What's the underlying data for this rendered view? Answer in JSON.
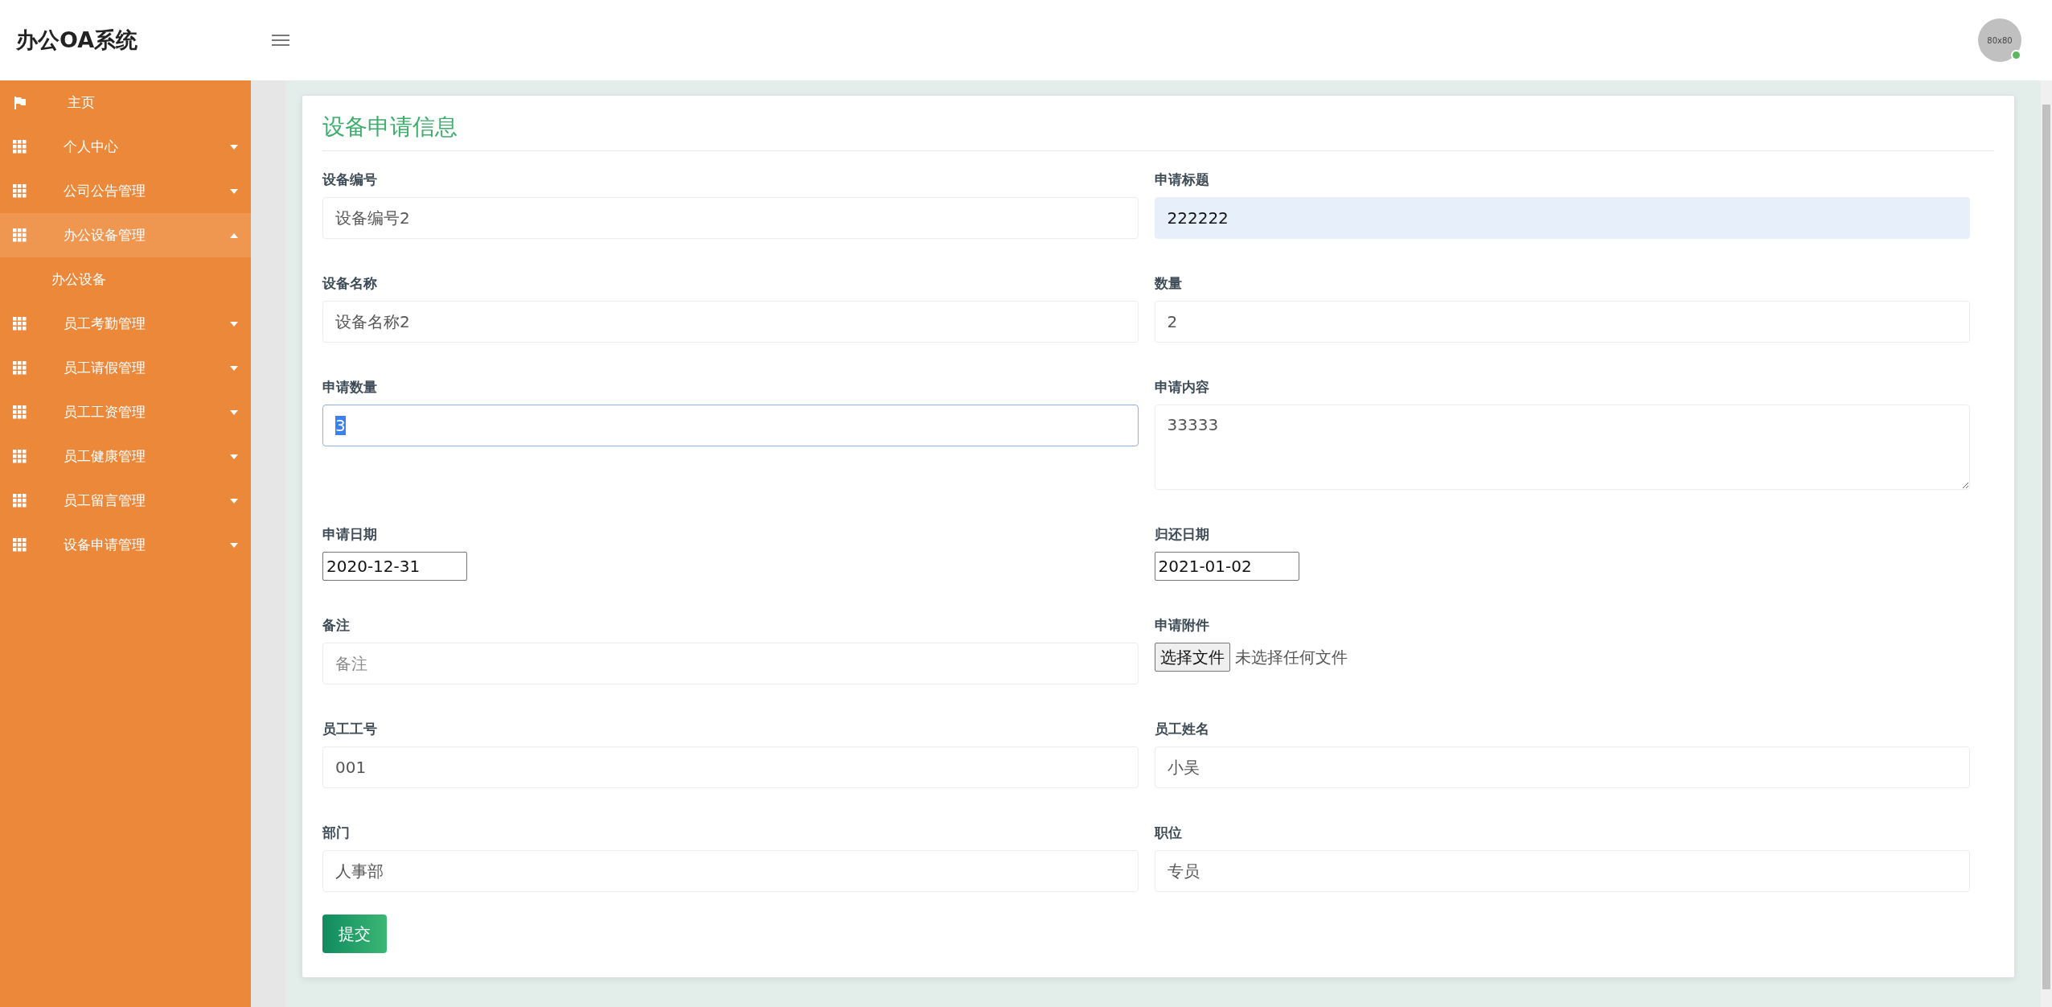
{
  "header": {
    "brand": "办公OA系统",
    "avatar": {
      "text": "80x80",
      "online": true
    }
  },
  "sidebar": {
    "items": [
      {
        "kind": "link",
        "label": "主页"
      },
      {
        "kind": "menu",
        "label": "个人中心",
        "expanded": false
      },
      {
        "kind": "menu",
        "label": "公司公告管理",
        "expanded": false
      },
      {
        "kind": "menu",
        "label": "办公设备管理",
        "expanded": true,
        "children": [
          {
            "label": "办公设备"
          }
        ]
      },
      {
        "kind": "menu",
        "label": "员工考勤管理",
        "expanded": false
      },
      {
        "kind": "menu",
        "label": "员工请假管理",
        "expanded": false
      },
      {
        "kind": "menu",
        "label": "员工工资管理",
        "expanded": false
      },
      {
        "kind": "menu",
        "label": "员工健康管理",
        "expanded": false
      },
      {
        "kind": "menu",
        "label": "员工留言管理",
        "expanded": false
      },
      {
        "kind": "menu",
        "label": "设备申请管理",
        "expanded": false
      }
    ]
  },
  "form": {
    "title": "设备申请信息",
    "fields": [
      {
        "kind": "text",
        "label": "设备编号",
        "value": "设备编号2"
      },
      {
        "kind": "autofill",
        "label": "申请标题",
        "value": "222222"
      },
      {
        "kind": "text",
        "label": "设备名称",
        "value": "设备名称2"
      },
      {
        "kind": "text",
        "label": "数量",
        "value": "2"
      },
      {
        "kind": "focused",
        "label": "申请数量",
        "value": "3"
      },
      {
        "kind": "textarea",
        "label": "申请内容",
        "value": "33333"
      },
      {
        "kind": "date",
        "label": "申请日期",
        "value": "2020-12-31"
      },
      {
        "kind": "date",
        "label": "归还日期",
        "value": "2021-01-02"
      },
      {
        "kind": "text",
        "label": "备注",
        "placeholder": "备注"
      },
      {
        "kind": "file",
        "label": "申请附件",
        "button": "选择文件",
        "status": "未选择任何文件"
      },
      {
        "kind": "text",
        "label": "员工工号",
        "value": "001"
      },
      {
        "kind": "text",
        "label": "员工姓名",
        "value": "小吴"
      },
      {
        "kind": "text",
        "label": "部门",
        "value": "人事部"
      },
      {
        "kind": "text",
        "label": "职位",
        "value": "专员"
      }
    ],
    "submit": "提交"
  }
}
